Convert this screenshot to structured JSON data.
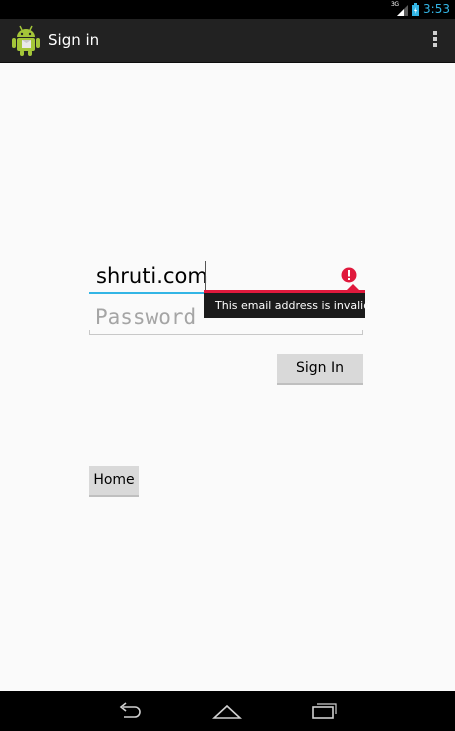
{
  "status_bar": {
    "network_type": "3G",
    "time": "3:53",
    "icons": [
      "signal-icon",
      "battery-icon"
    ],
    "accent_color": "#33b5e5"
  },
  "action_bar": {
    "title": "Sign in",
    "app_icon": "android-robot-icon",
    "menu_icon": "overflow-menu-icon"
  },
  "form": {
    "email_value": "shruti.com",
    "email_error_icon": "error-icon",
    "error_message": "This email address is invalid",
    "error_color": "#e0193c",
    "password_placeholder": "Password",
    "sign_in_label": "Sign In",
    "home_label": "Home"
  },
  "nav_bar": {
    "icons": [
      "back-icon",
      "home-icon",
      "recents-icon"
    ]
  }
}
